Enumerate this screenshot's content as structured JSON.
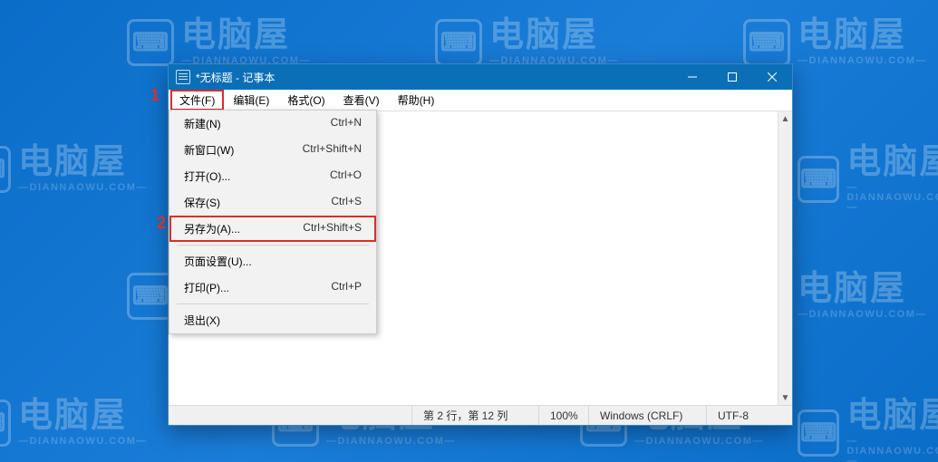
{
  "watermark": {
    "main": "电脑屋",
    "sub": "—DIANNAOWU.COM—"
  },
  "annotations": {
    "one": "1",
    "two": "2"
  },
  "window": {
    "title": "*无标题 - 记事本"
  },
  "menubar": {
    "file": "文件(F)",
    "edit": "编辑(E)",
    "format": "格式(O)",
    "view": "查看(V)",
    "help": "帮助(H)"
  },
  "file_menu": {
    "new": {
      "label": "新建(N)",
      "shortcut": "Ctrl+N"
    },
    "new_window": {
      "label": "新窗口(W)",
      "shortcut": "Ctrl+Shift+N"
    },
    "open": {
      "label": "打开(O)...",
      "shortcut": "Ctrl+O"
    },
    "save": {
      "label": "保存(S)",
      "shortcut": "Ctrl+S"
    },
    "save_as": {
      "label": "另存为(A)...",
      "shortcut": "Ctrl+Shift+S"
    },
    "page_setup": {
      "label": "页面设置(U)...",
      "shortcut": ""
    },
    "print": {
      "label": "打印(P)...",
      "shortcut": "Ctrl+P"
    },
    "exit": {
      "label": "退出(X)",
      "shortcut": ""
    }
  },
  "statusbar": {
    "position": "第 2 行，第 12 列",
    "zoom": "100%",
    "line_endings": "Windows (CRLF)",
    "encoding": "UTF-8"
  }
}
